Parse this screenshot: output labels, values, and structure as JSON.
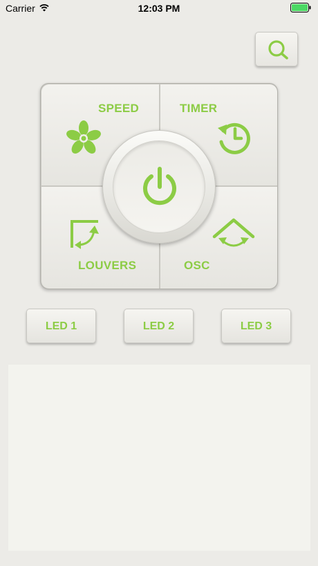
{
  "status_bar": {
    "carrier": "Carrier",
    "time": "12:03 PM",
    "battery_color": "#4cd964"
  },
  "accent_color": "#8ccc45",
  "controls": {
    "speed": {
      "label": "SPEED",
      "icon": "fan-icon"
    },
    "timer": {
      "label": "TIMER",
      "icon": "timer-icon"
    },
    "louvers": {
      "label": "LOUVERS",
      "icon": "louvers-icon"
    },
    "osc": {
      "label": "OSC",
      "icon": "oscillation-icon"
    },
    "power": {
      "icon": "power-icon"
    },
    "search": {
      "icon": "search-icon"
    }
  },
  "leds": [
    {
      "label": "LED 1"
    },
    {
      "label": "LED 2"
    },
    {
      "label": "LED 3"
    }
  ]
}
